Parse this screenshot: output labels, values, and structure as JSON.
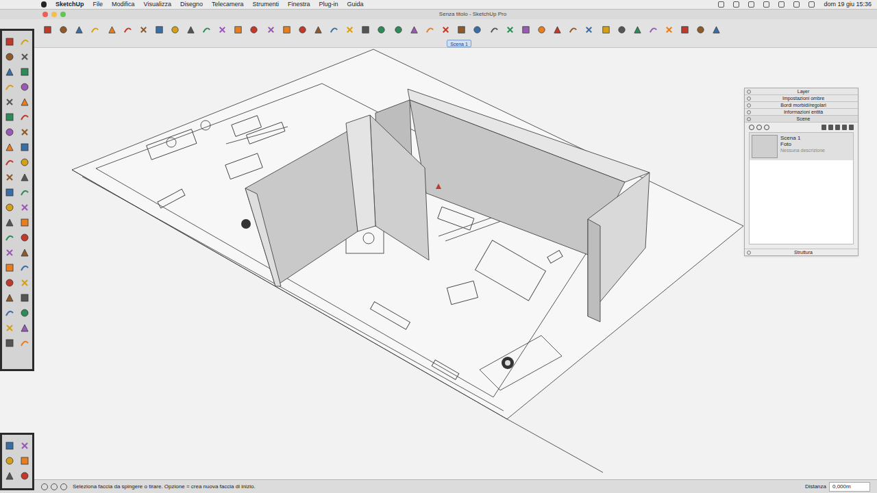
{
  "menubar": {
    "app": "SketchUp",
    "items": [
      "File",
      "Modifica",
      "Visualizza",
      "Disegno",
      "Telecamera",
      "Strumenti",
      "Finestra",
      "Plug-in",
      "Guida"
    ],
    "clock": "dom 19 giu 15:36"
  },
  "window": {
    "title": "Senza titolo - SketchUp Pro"
  },
  "scene_tabs": [
    {
      "label": "Scena 1",
      "selected": true
    }
  ],
  "tray": {
    "sections": [
      {
        "label": "Layer",
        "expanded": false
      },
      {
        "label": "Impostazioni ombre",
        "expanded": false
      },
      {
        "label": "Bordi morbidi/regolari",
        "expanded": false
      },
      {
        "label": "Informazioni entità",
        "expanded": false
      },
      {
        "label": "Scene",
        "expanded": true
      }
    ],
    "scenes": [
      {
        "name": "Scena 1",
        "subtitle": "Foto",
        "description": "Nessuna descrizione",
        "selected": true
      }
    ],
    "footer": "Struttura"
  },
  "status_bar": {
    "hint": "Seleziona faccia da spingere o tirare. Opzione = crea nuova faccia di inizio.",
    "measure_label": "Distanza",
    "measure_value": "0,000m"
  }
}
